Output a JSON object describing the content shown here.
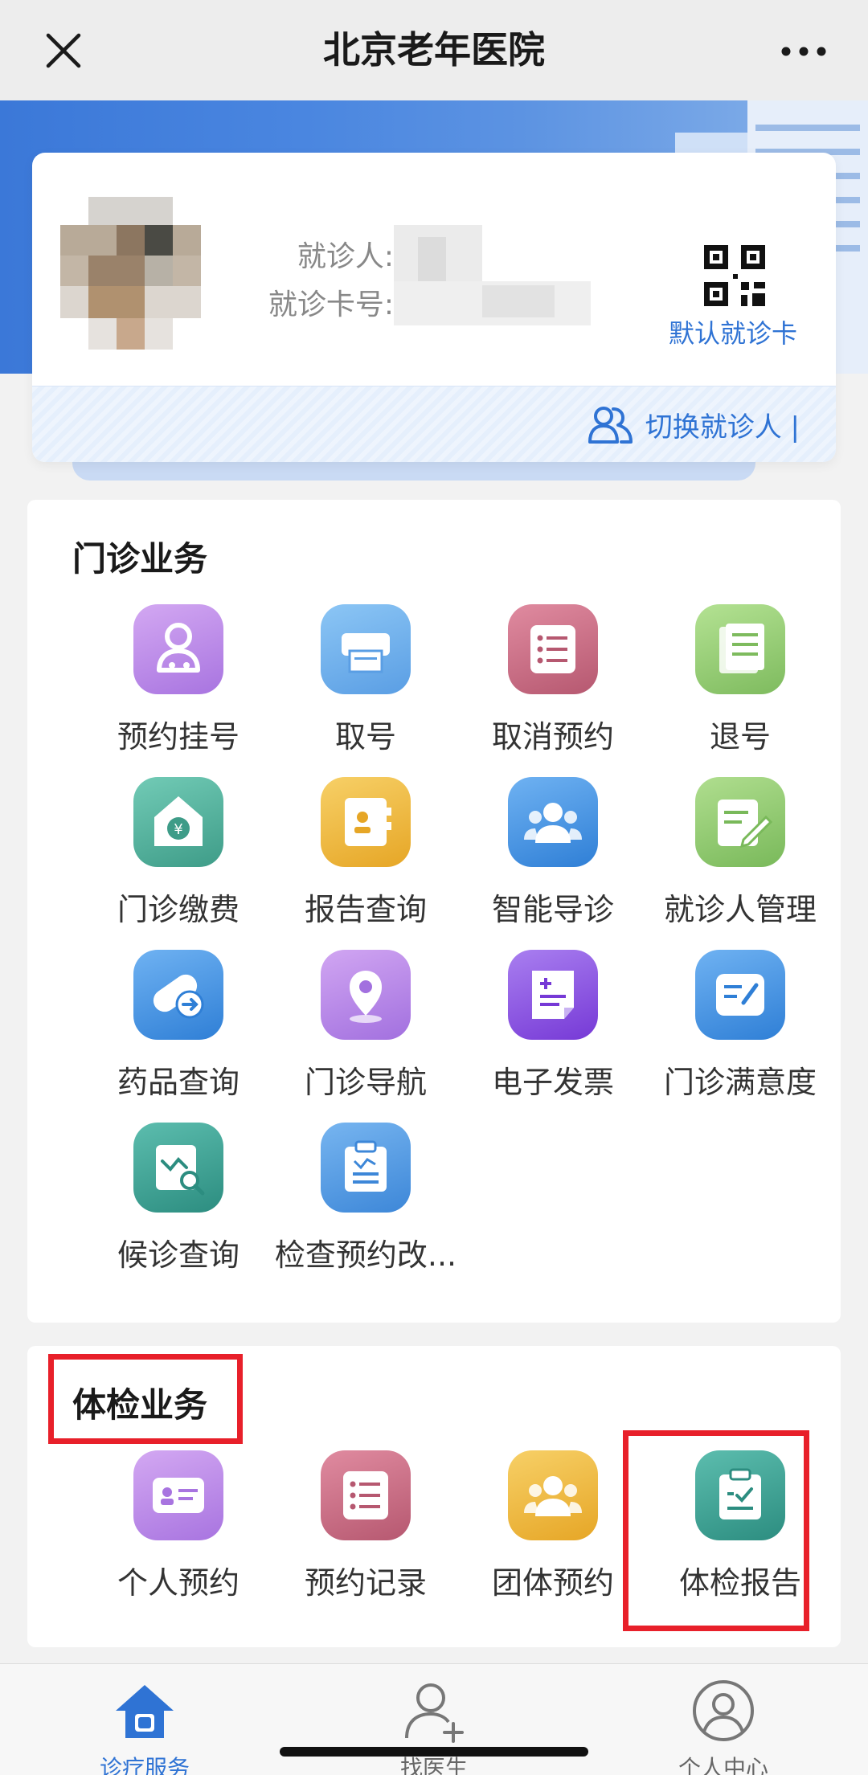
{
  "header": {
    "title": "北京老年医院",
    "close_icon": "close-icon",
    "more_icon": "more-icon"
  },
  "patient_card": {
    "name_label": "就诊人:",
    "card_label": "就诊卡号:",
    "default_card_link": "默认就诊卡",
    "switch_patient": "切换就诊人 |"
  },
  "outpatient": {
    "title": "门诊业务",
    "items": [
      {
        "label": "预约挂号",
        "icon": "doctor-icon",
        "color": "#b889e6"
      },
      {
        "label": "取号",
        "icon": "printer-icon",
        "color": "#6aaeea"
      },
      {
        "label": "取消预约",
        "icon": "list-icon",
        "color": "#c9697f"
      },
      {
        "label": "退号",
        "icon": "document-icon",
        "color": "#8fcb6c"
      },
      {
        "label": "门诊缴费",
        "icon": "payment-icon",
        "color": "#4cae99"
      },
      {
        "label": "报告查询",
        "icon": "report-icon",
        "color": "#f0b83c"
      },
      {
        "label": "智能导诊",
        "icon": "group-icon",
        "color": "#3d8ee0"
      },
      {
        "label": "就诊人管理",
        "icon": "edit-icon",
        "color": "#86c56a"
      },
      {
        "label": "药品查询",
        "icon": "pill-icon",
        "color": "#3e8fe0"
      },
      {
        "label": "门诊导航",
        "icon": "location-icon",
        "color": "#b47fe3"
      },
      {
        "label": "电子发票",
        "icon": "invoice-icon",
        "color": "#8a4ce0"
      },
      {
        "label": "门诊满意度",
        "icon": "survey-icon",
        "color": "#3e8fe0"
      },
      {
        "label": "候诊查询",
        "icon": "search-chart-icon",
        "color": "#3a9f92"
      },
      {
        "label": "检查预约改...",
        "icon": "clipboard-icon",
        "color": "#4b98e2"
      }
    ]
  },
  "checkup": {
    "title": "体检业务",
    "items": [
      {
        "label": "个人预约",
        "icon": "id-card-icon",
        "color": "#b889e6"
      },
      {
        "label": "预约记录",
        "icon": "list-icon",
        "color": "#c9697f"
      },
      {
        "label": "团体预约",
        "icon": "group-icon",
        "color": "#f0b83c"
      },
      {
        "label": "体检报告",
        "icon": "clipboard-check-icon",
        "color": "#3a9f92"
      }
    ]
  },
  "tabbar": {
    "tabs": [
      {
        "label": "诊疗服务",
        "active": true
      },
      {
        "label": "找医生",
        "active": false
      },
      {
        "label": "个人中心",
        "active": false
      }
    ]
  }
}
